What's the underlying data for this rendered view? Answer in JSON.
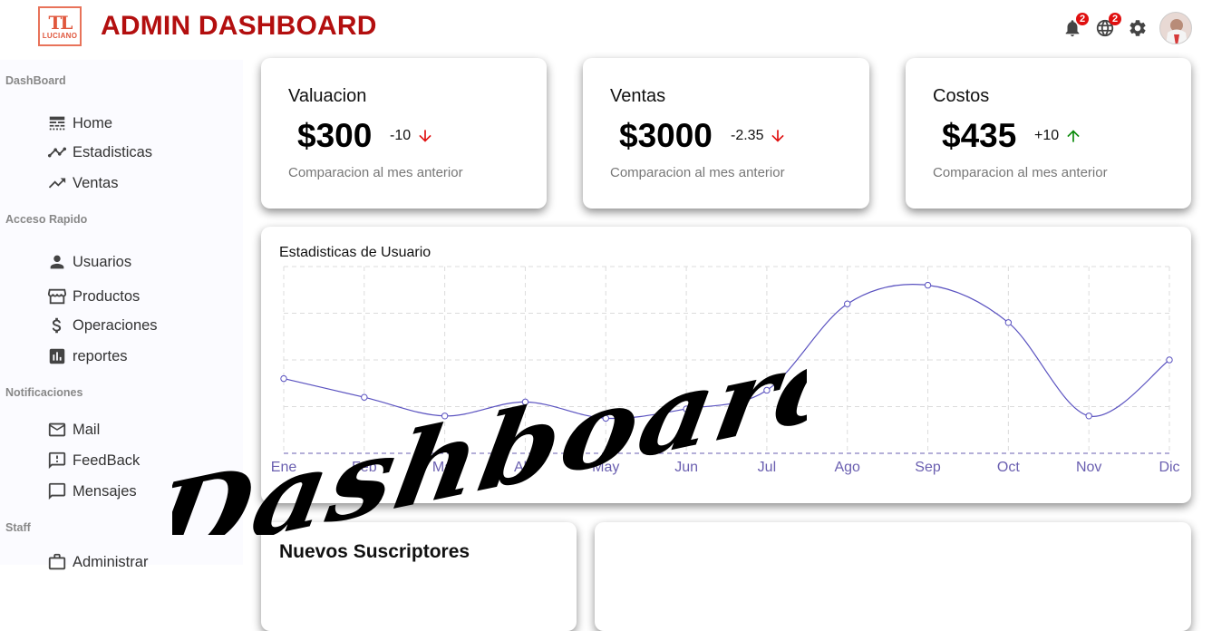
{
  "header": {
    "logo_mono": "TL",
    "logo_word": "LUCIANO",
    "title": "ADMIN DASHBOARD",
    "notifications_count": "2",
    "language_count": "2"
  },
  "sidebar": {
    "sections": [
      {
        "title": "DashBoard",
        "items": [
          {
            "label": "Home",
            "icon": "line-style-icon"
          },
          {
            "label": "Estadisticas",
            "icon": "timeline-icon"
          },
          {
            "label": "Ventas",
            "icon": "trending-up-icon"
          }
        ]
      },
      {
        "title": "Acceso Rapido",
        "items": [
          {
            "label": "Usuarios",
            "icon": "person-icon"
          },
          {
            "label": "Productos",
            "icon": "storefront-icon"
          },
          {
            "label": "Operaciones",
            "icon": "dollar-icon"
          },
          {
            "label": "reportes",
            "icon": "bar-chart-icon"
          }
        ]
      },
      {
        "title": "Notificaciones",
        "items": [
          {
            "label": "Mail",
            "icon": "mail-icon"
          },
          {
            "label": "FeedBack",
            "icon": "feedback-icon"
          },
          {
            "label": "Mensajes",
            "icon": "chat-icon"
          }
        ]
      },
      {
        "title": "Staff",
        "items": [
          {
            "label": "Administrar",
            "icon": "work-icon"
          }
        ]
      }
    ]
  },
  "kpis": [
    {
      "title": "Valuacion",
      "value": "$300",
      "delta": "-10",
      "trend": "down",
      "subtitle": "Comparacion al mes anterior"
    },
    {
      "title": "Ventas",
      "value": "$3000",
      "delta": "-2.35",
      "trend": "down",
      "subtitle": "Comparacion al mes anterior"
    },
    {
      "title": "Costos",
      "value": "$435",
      "delta": "+10",
      "trend": "up",
      "subtitle": "Comparacion al mes anterior"
    }
  ],
  "colors": {
    "brand": "#b30f0f",
    "trend_down": "#e01010",
    "trend_up": "#0a8a0a",
    "chart_line": "#5a52c0"
  },
  "user_chart": {
    "title": "Estadisticas de Usuario"
  },
  "chart_data": {
    "type": "line",
    "title": "Estadisticas de Usuario",
    "categories": [
      "Ene",
      "Feb",
      "Mar",
      "Abr",
      "May",
      "Jun",
      "Jul",
      "Ago",
      "Sep",
      "Oct",
      "Nov",
      "Dic"
    ],
    "series": [
      {
        "values": [
          1600,
          1200,
          800,
          1100,
          750,
          950,
          1350,
          3200,
          3600,
          2800,
          800,
          2000
        ]
      }
    ],
    "ylim": [
      0,
      4000
    ],
    "grid": true,
    "legend": "none"
  },
  "bottom": {
    "subscribers_title": "Nuevos Suscriptores"
  },
  "watermark_text": "Dashboard"
}
